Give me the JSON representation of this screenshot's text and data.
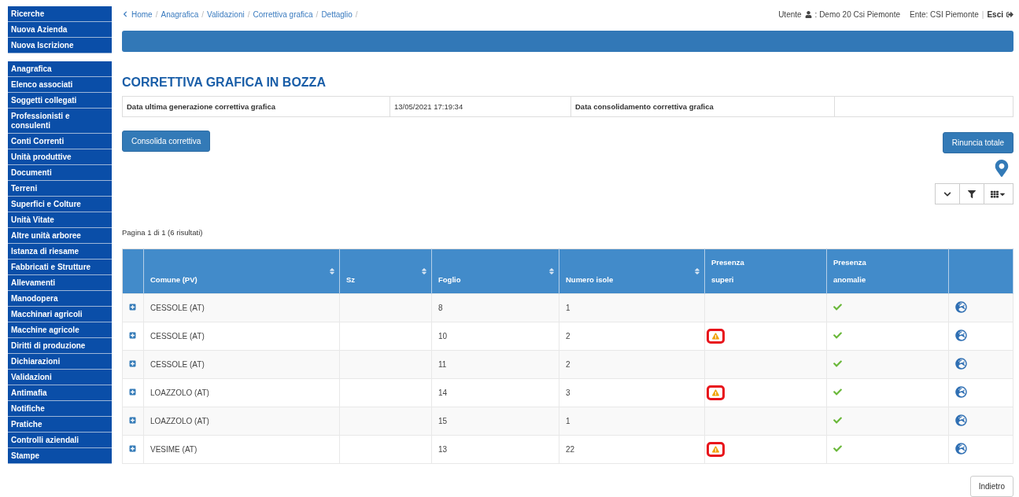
{
  "sidebar": {
    "groups": [
      {
        "items": [
          "Ricerche",
          "Nuova Azienda",
          "Nuova Iscrizione"
        ]
      },
      {
        "items": [
          "Anagrafica",
          "Elenco associati",
          "Soggetti collegati",
          "Professionisti e consulenti",
          "Conti Correnti",
          "Unità produttive",
          "Documenti",
          "Terreni",
          "Superfici e Colture",
          "Unità Vitate",
          "Altre unità arboree",
          "Istanza di riesame",
          "Fabbricati e Strutture",
          "Allevamenti",
          "Manodopera",
          "Macchinari agricoli",
          "Macchine agricole",
          "Diritti di produzione",
          "Dichiarazioni",
          "Validazioni",
          "Antimafia",
          "Notifiche",
          "Pratiche",
          "Controlli aziendali",
          "Stampe"
        ]
      }
    ]
  },
  "breadcrumb": {
    "separator": "/",
    "items": [
      "Home",
      "Anagrafica",
      "Validazioni",
      "Correttiva grafica",
      "Dettaglio"
    ]
  },
  "user": {
    "label": "Utente",
    "name": ": Demo 20 Csi Piemonte",
    "ente": "Ente: CSI Piemonte",
    "divider": "|",
    "logout": "Esci"
  },
  "title": "CORRETTIVA GRAFICA IN BOZZA",
  "info": [
    {
      "label": "Data ultima generazione correttiva grafica",
      "value": "13/05/2021 17:19:34"
    },
    {
      "label": "Data consolidamento correttiva grafica"
    }
  ],
  "actions": {
    "left": "Consolida correttiva",
    "right": "Rinuncia totale"
  },
  "pagination": "Pagina 1 di 1 (6 risultati)",
  "table": {
    "columns": [
      {
        "label": "Comune (PV)",
        "sortable": true
      },
      {
        "label": "Sz",
        "sortable": true
      },
      {
        "label": "Foglio",
        "sortable": true
      },
      {
        "label": "Numero isole",
        "sortable": true
      },
      {
        "label": "Presenza superi",
        "sortable": false
      },
      {
        "label": "Presenza anomalie",
        "sortable": false
      }
    ],
    "rows": [
      {
        "comune": "CESSOLE (AT)",
        "foglio": "8",
        "isole": "1",
        "superi": false,
        "anomalie": true
      },
      {
        "comune": "CESSOLE (AT)",
        "foglio": "10",
        "isole": "2",
        "superi": true,
        "anomalie": true
      },
      {
        "comune": "CESSOLE (AT)",
        "foglio": "11",
        "isole": "2",
        "superi": false,
        "anomalie": true
      },
      {
        "comune": "LOAZZOLO (AT)",
        "foglio": "14",
        "isole": "3",
        "superi": true,
        "anomalie": true
      },
      {
        "comune": "LOAZZOLO (AT)",
        "foglio": "15",
        "isole": "1",
        "superi": false,
        "anomalie": true
      },
      {
        "comune": "VESIME (AT)",
        "foglio": "13",
        "isole": "22",
        "superi": true,
        "anomalie": true
      }
    ]
  },
  "back": "Indietro"
}
